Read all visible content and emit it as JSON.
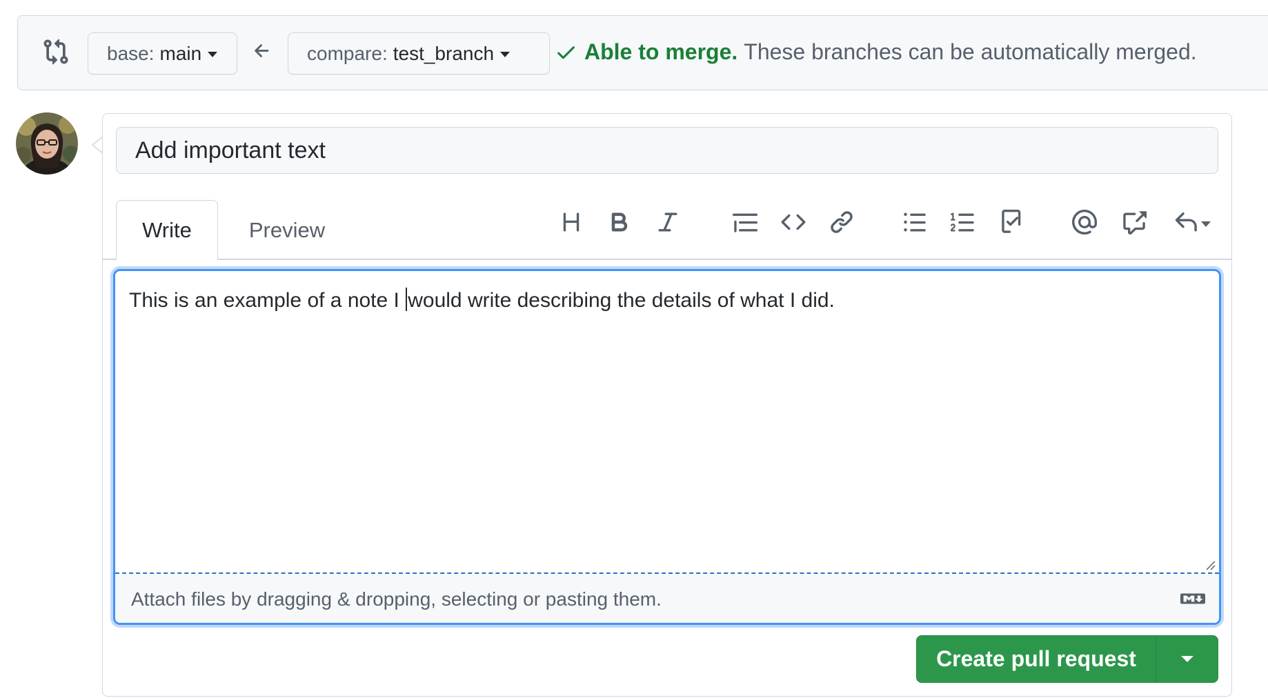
{
  "compare_bar": {
    "base_prefix": "base:",
    "base_branch": "main",
    "compare_prefix": "compare:",
    "compare_branch": "test_branch",
    "merge_ok": "Able to merge.",
    "merge_message": "These branches can be automatically merged."
  },
  "pull_request": {
    "title_value": "Add important text",
    "tabs": {
      "write": "Write",
      "preview": "Preview"
    },
    "body_before_cursor": "This is an example of a note I ",
    "body_after_cursor": "would write describing the details of what I did.",
    "attach_hint": "Attach files by dragging & dropping, selecting or pasting them.",
    "create_button": "Create pull request"
  },
  "toolbar": {
    "icons": [
      "heading-icon",
      "bold-icon",
      "italic-icon",
      "quote-icon",
      "code-icon",
      "link-icon",
      "bulleted-list-icon",
      "numbered-list-icon",
      "task-list-icon",
      "mention-icon",
      "cross-reference-icon",
      "reply-icon"
    ]
  },
  "colors": {
    "accent_green": "#1a7f37",
    "button_green": "#2c974b",
    "focus_blue": "#4493f8"
  }
}
